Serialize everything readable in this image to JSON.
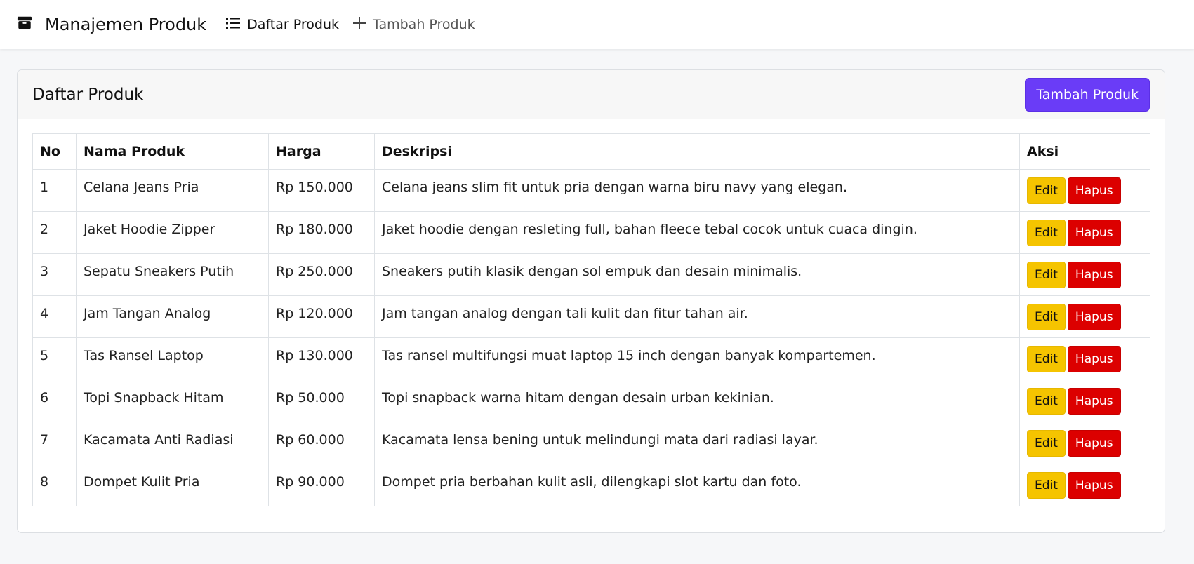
{
  "navbar": {
    "brand": "Manajemen Produk",
    "brand_icon": "box-icon",
    "links": [
      {
        "label": "Daftar Produk",
        "icon": "list-icon",
        "active": true
      },
      {
        "label": "Tambah Produk",
        "icon": "plus-icon",
        "active": false
      }
    ]
  },
  "card": {
    "title": "Daftar Produk",
    "add_button": "Tambah Produk"
  },
  "table": {
    "headers": [
      "No",
      "Nama Produk",
      "Harga",
      "Deskripsi",
      "Aksi"
    ],
    "edit_label": "Edit",
    "delete_label": "Hapus",
    "rows": [
      {
        "no": "1",
        "nama": "Celana Jeans Pria",
        "harga": "Rp 150.000",
        "deskripsi": "Celana jeans slim fit untuk pria dengan warna biru navy yang elegan."
      },
      {
        "no": "2",
        "nama": "Jaket Hoodie Zipper",
        "harga": "Rp 180.000",
        "deskripsi": "Jaket hoodie dengan resleting full, bahan fleece tebal cocok untuk cuaca dingin."
      },
      {
        "no": "3",
        "nama": "Sepatu Sneakers Putih",
        "harga": "Rp 250.000",
        "deskripsi": "Sneakers putih klasik dengan sol empuk dan desain minimalis."
      },
      {
        "no": "4",
        "nama": "Jam Tangan Analog",
        "harga": "Rp 120.000",
        "deskripsi": "Jam tangan analog dengan tali kulit dan fitur tahan air."
      },
      {
        "no": "5",
        "nama": "Tas Ransel Laptop",
        "harga": "Rp 130.000",
        "deskripsi": "Tas ransel multifungsi muat laptop 15 inch dengan banyak kompartemen."
      },
      {
        "no": "6",
        "nama": "Topi Snapback Hitam",
        "harga": "Rp 50.000",
        "deskripsi": "Topi snapback warna hitam dengan desain urban kekinian."
      },
      {
        "no": "7",
        "nama": "Kacamata Anti Radiasi",
        "harga": "Rp 60.000",
        "deskripsi": "Kacamata lensa bening untuk melindungi mata dari radiasi layar."
      },
      {
        "no": "8",
        "nama": "Dompet Kulit Pria",
        "harga": "Rp 90.000",
        "deskripsi": "Dompet pria berbahan kulit asli, dilengkapi slot kartu dan foto."
      }
    ]
  },
  "colors": {
    "primary": "#6a3cf7",
    "edit": "#f5c400",
    "delete": "#dc0000",
    "background": "#f6f7f9"
  }
}
